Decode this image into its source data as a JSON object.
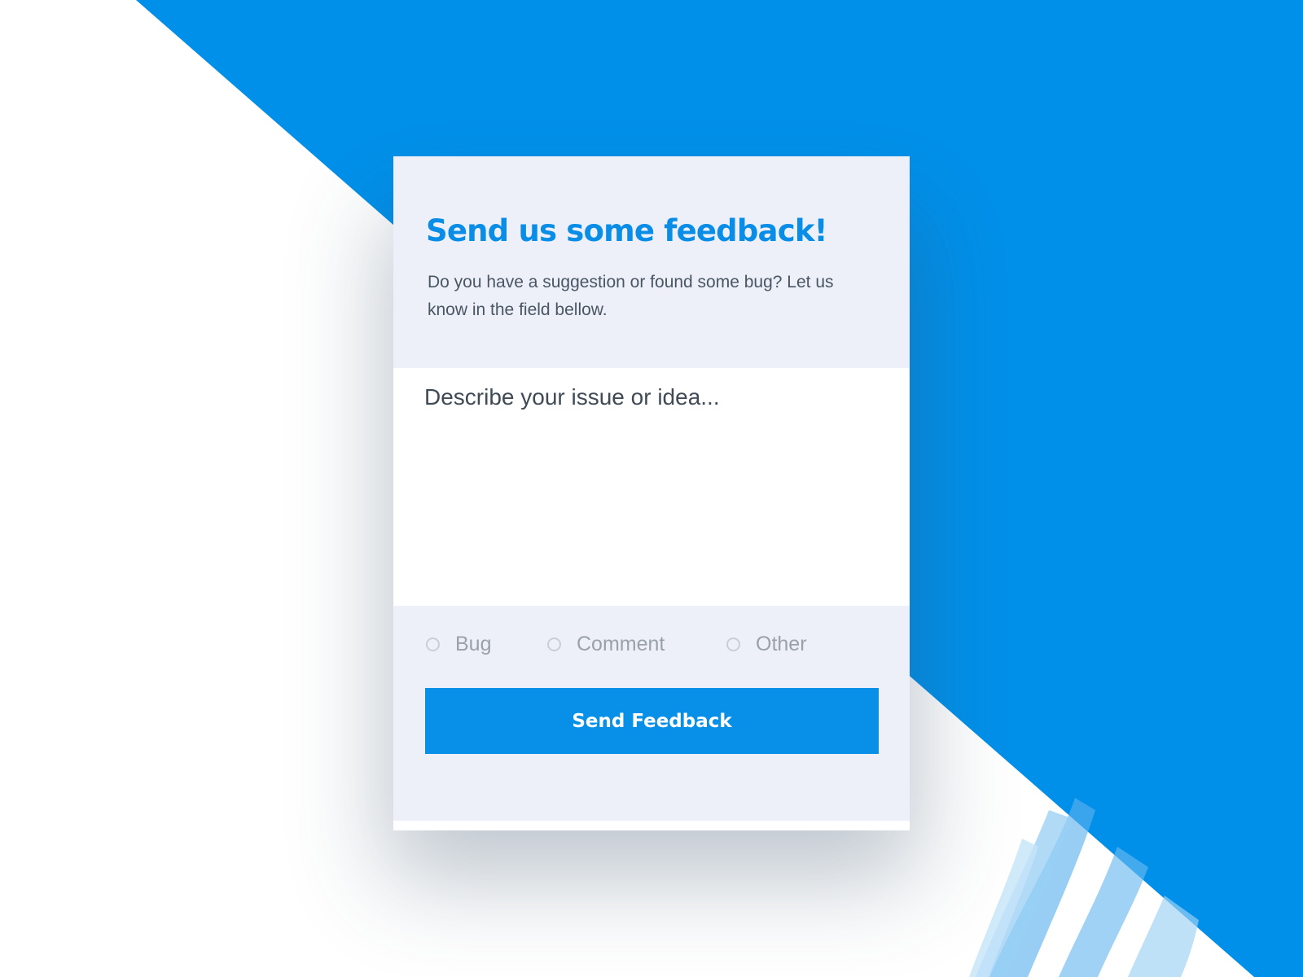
{
  "colors": {
    "accent": "#0890e8",
    "background": "#ffffff",
    "card": "#edf0f8",
    "input_background": "#ffffff",
    "title": "#0a8de6",
    "body_text": "#4a5663",
    "muted_text": "#9aa1ab"
  },
  "feedback": {
    "title": "Send us some feedback!",
    "description": "Do you have a suggestion or found some bug? Let us know in the field bellow.",
    "message": {
      "placeholder": "Describe your issue or idea...",
      "value": ""
    },
    "types": [
      {
        "label": "Bug",
        "selected": false
      },
      {
        "label": "Comment",
        "selected": false
      },
      {
        "label": "Other",
        "selected": false
      }
    ],
    "submit_label": "Send Feedback"
  }
}
